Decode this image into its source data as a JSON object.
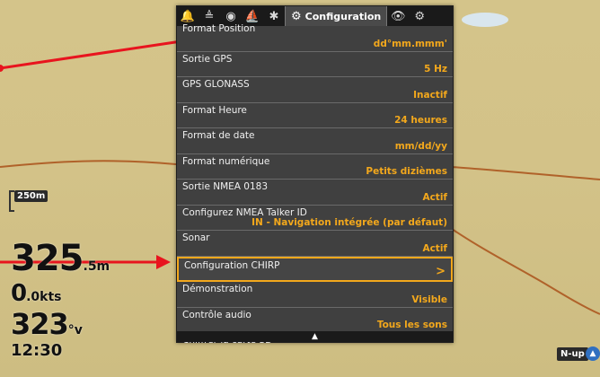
{
  "menu": {
    "tabs": [
      {
        "icon": "bell-icon",
        "glyph": "🔔"
      },
      {
        "icon": "sonar-icon",
        "glyph": "≜"
      },
      {
        "icon": "compass-icon",
        "glyph": "◉"
      },
      {
        "icon": "chart-icon",
        "glyph": "⛵"
      },
      {
        "icon": "satellite-icon",
        "glyph": "✱"
      }
    ],
    "active_tab": "Configuration",
    "trailing_tabs": [
      {
        "icon": "eye-icon",
        "glyph": "👁"
      },
      {
        "icon": "accessories-icon",
        "glyph": "⚙"
      }
    ],
    "items": [
      {
        "label": "Format Position",
        "value": "dd°mm.mmm'"
      },
      {
        "label": "Sortie GPS",
        "value": "5 Hz"
      },
      {
        "label": "GPS GLONASS",
        "value": "Inactif"
      },
      {
        "label": "Format Heure",
        "value": "24 heures"
      },
      {
        "label": "Format de date",
        "value": "mm/dd/yy"
      },
      {
        "label": "Format numérique",
        "value": "Petits dizièmes"
      },
      {
        "label": "Sortie NMEA 0183",
        "value": "Actif"
      },
      {
        "label": "Configurez NMEA Talker ID",
        "value": "IN - Navigation intégrée (par défaut)"
      },
      {
        "label": "Sonar",
        "value": "Actif"
      },
      {
        "label": "Configuration CHIRP",
        "value": ">"
      },
      {
        "label": "Démonstration",
        "value": "Visible"
      },
      {
        "label": "Contrôle audio",
        "value": "Tous les sons"
      },
      {
        "label": "Chiffrer la carte SD",
        "value": ""
      }
    ],
    "selected_index": 9
  },
  "readouts": {
    "scale": "250m",
    "depth_value": "325",
    "depth_unit": ".5m",
    "speed_value": "0",
    "speed_unit": ".0kts",
    "heading_value": "323",
    "heading_unit": "°v",
    "time": "12:30"
  },
  "orientation": "N-up",
  "colors": {
    "accent": "#f3a81c",
    "callout_arrow": "#e8141e",
    "map_land": "#d3c288",
    "contour": "#b0622a"
  }
}
